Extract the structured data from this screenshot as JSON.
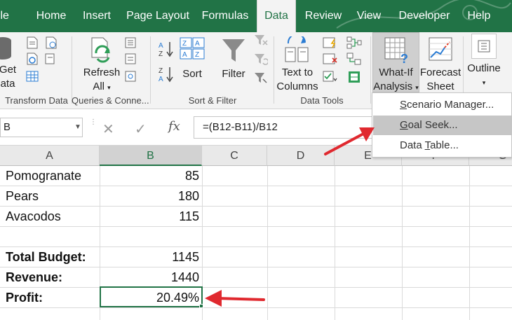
{
  "tabs": [
    {
      "label": "File"
    },
    {
      "label": "Home"
    },
    {
      "label": "Insert"
    },
    {
      "label": "Page Layout"
    },
    {
      "label": "Formulas"
    },
    {
      "label": "Data"
    },
    {
      "label": "Review"
    },
    {
      "label": "View"
    },
    {
      "label": "Developer"
    },
    {
      "label": "Help"
    }
  ],
  "ribbon": {
    "get_data": {
      "line1": "Get",
      "line2": "ata"
    },
    "groups": {
      "transform": "Transform Data",
      "queries": "Queries & Conne...",
      "sort_filter": "Sort & Filter",
      "data_tools": "Data Tools"
    },
    "refresh": {
      "line1": "Refresh",
      "line2": "All"
    },
    "sort": "Sort",
    "filter": "Filter",
    "text_to_columns": {
      "line1": "Text to",
      "line2": "Columns"
    },
    "what_if": {
      "line1": "What-If",
      "line2": "Analysis"
    },
    "forecast": {
      "line1": "Forecast",
      "line2": "Sheet"
    },
    "outline": "Outline"
  },
  "formula_bar": {
    "name_box": "B",
    "formula": "=(B12-B11)/B12"
  },
  "columns": [
    "A",
    "B",
    "C",
    "D",
    "E",
    "F",
    "G"
  ],
  "rows": [
    {
      "label": "Pomogranate",
      "value": "85"
    },
    {
      "label": "Pears",
      "value": "180"
    },
    {
      "label": "Avacodos",
      "value": "115"
    },
    {
      "label": "",
      "value": ""
    },
    {
      "label": "Total Budget:",
      "value": "1145"
    },
    {
      "label": "Revenue:",
      "value": "1440"
    },
    {
      "label": "Profit:",
      "value": "20.49%"
    }
  ],
  "dropdown": {
    "items": [
      {
        "prefix": "",
        "underline": "S",
        "rest": "cenario Manager..."
      },
      {
        "prefix": "",
        "underline": "G",
        "rest": "oal Seek..."
      },
      {
        "prefix": "Data ",
        "underline": "T",
        "rest": "able..."
      }
    ]
  },
  "colors": {
    "excel_green": "#217346",
    "annotation_red": "#e0292f"
  }
}
